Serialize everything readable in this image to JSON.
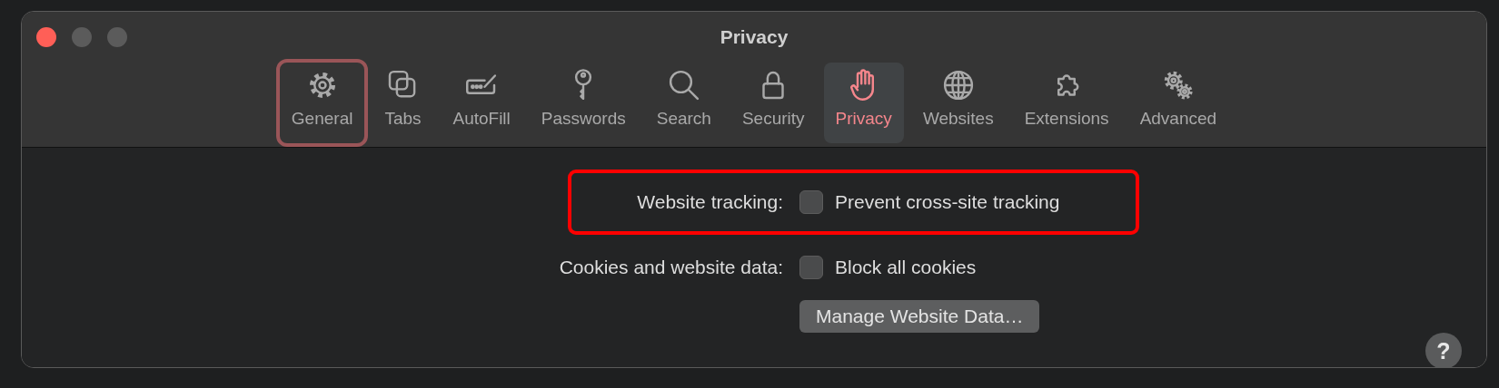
{
  "window": {
    "title": "Privacy",
    "controls": [
      {
        "kind": "close",
        "disabled": false
      },
      {
        "kind": "minimize",
        "disabled": true
      },
      {
        "kind": "zoom",
        "disabled": true
      }
    ]
  },
  "toolbar": [
    {
      "label": "General",
      "selected": false,
      "highlighted": true
    },
    {
      "label": "Tabs",
      "selected": false,
      "highlighted": false
    },
    {
      "label": "AutoFill",
      "selected": false,
      "highlighted": false
    },
    {
      "label": "Passwords",
      "selected": false,
      "highlighted": false
    },
    {
      "label": "Search",
      "selected": false,
      "highlighted": false
    },
    {
      "label": "Security",
      "selected": false,
      "highlighted": false
    },
    {
      "label": "Privacy",
      "selected": true,
      "highlighted": false
    },
    {
      "label": "Websites",
      "selected": false,
      "highlighted": false
    },
    {
      "label": "Extensions",
      "selected": false,
      "highlighted": false
    },
    {
      "label": "Advanced",
      "selected": false,
      "highlighted": false
    }
  ],
  "settings": [
    {
      "label": "Website tracking:",
      "highlighted": true,
      "options": [
        {
          "kind": "checkbox",
          "text": "Prevent cross-site tracking",
          "checked": false
        }
      ]
    },
    {
      "label": "Cookies and website data:",
      "highlighted": false,
      "options": [
        {
          "kind": "checkbox",
          "text": "Block all cookies",
          "checked": false
        },
        {
          "kind": "button",
          "text": "Manage Website Data…"
        }
      ]
    }
  ],
  "help_button": {
    "label": "?"
  }
}
